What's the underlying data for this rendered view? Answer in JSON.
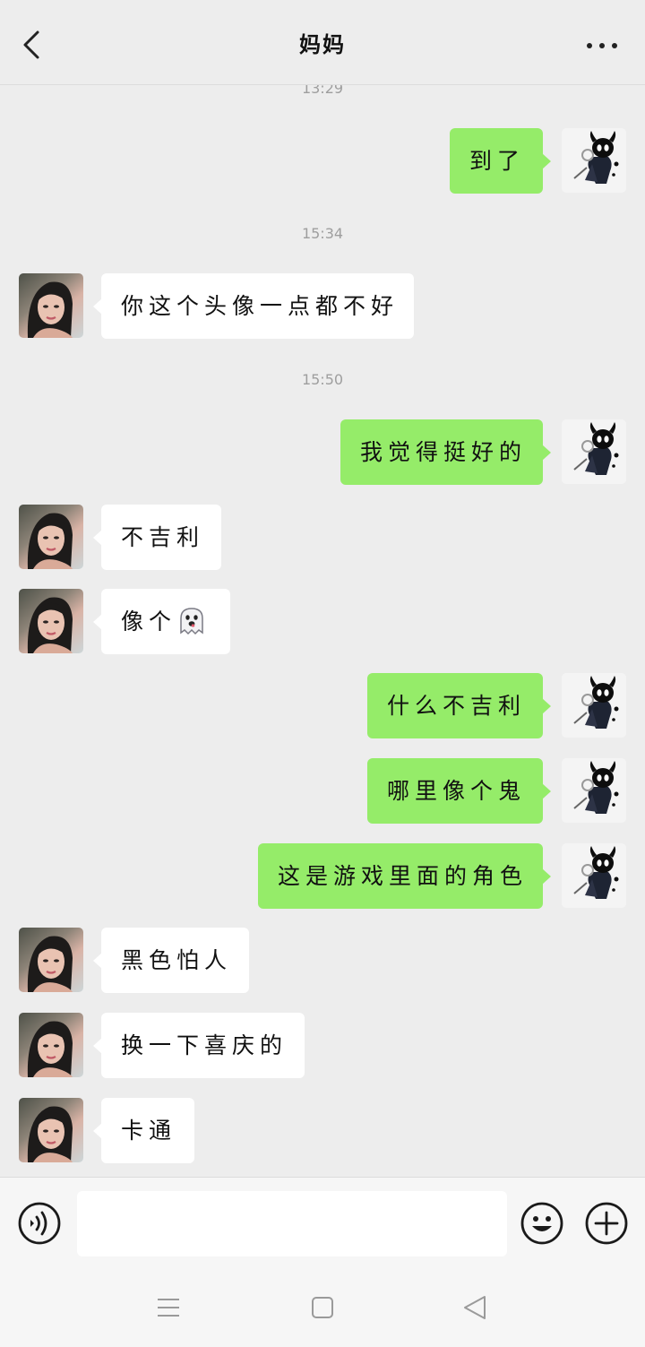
{
  "header": {
    "title": "妈妈",
    "back_icon": "chevron-left-icon",
    "more_icon": "more-dots-icon"
  },
  "chat": {
    "timestamps": [
      "13:29",
      "15:34",
      "15:50"
    ],
    "messages": [
      {
        "from": "me",
        "text": "到了"
      },
      {
        "from": "mom",
        "text": "你这个头像一点都不好"
      },
      {
        "from": "me",
        "text": "我觉得挺好的"
      },
      {
        "from": "mom",
        "text": "不吉利"
      },
      {
        "from": "mom",
        "text": "像个",
        "emoji": "ghost-emoji"
      },
      {
        "from": "me",
        "text": "什么不吉利"
      },
      {
        "from": "me",
        "text": "哪里像个鬼"
      },
      {
        "from": "me",
        "text": "这是游戏里面的角色"
      },
      {
        "from": "mom",
        "text": "黑色怕人"
      },
      {
        "from": "mom",
        "text": "换一下喜庆的"
      },
      {
        "from": "mom",
        "text": "卡通"
      }
    ]
  },
  "input_bar": {
    "value": "",
    "voice_icon": "voice-icon",
    "emoji_icon": "emoji-icon",
    "plus_icon": "plus-icon"
  },
  "colors": {
    "background": "#ededed",
    "sent_bubble": "#95ec69",
    "received_bubble": "#ffffff",
    "timestamp": "#9e9e9e"
  }
}
